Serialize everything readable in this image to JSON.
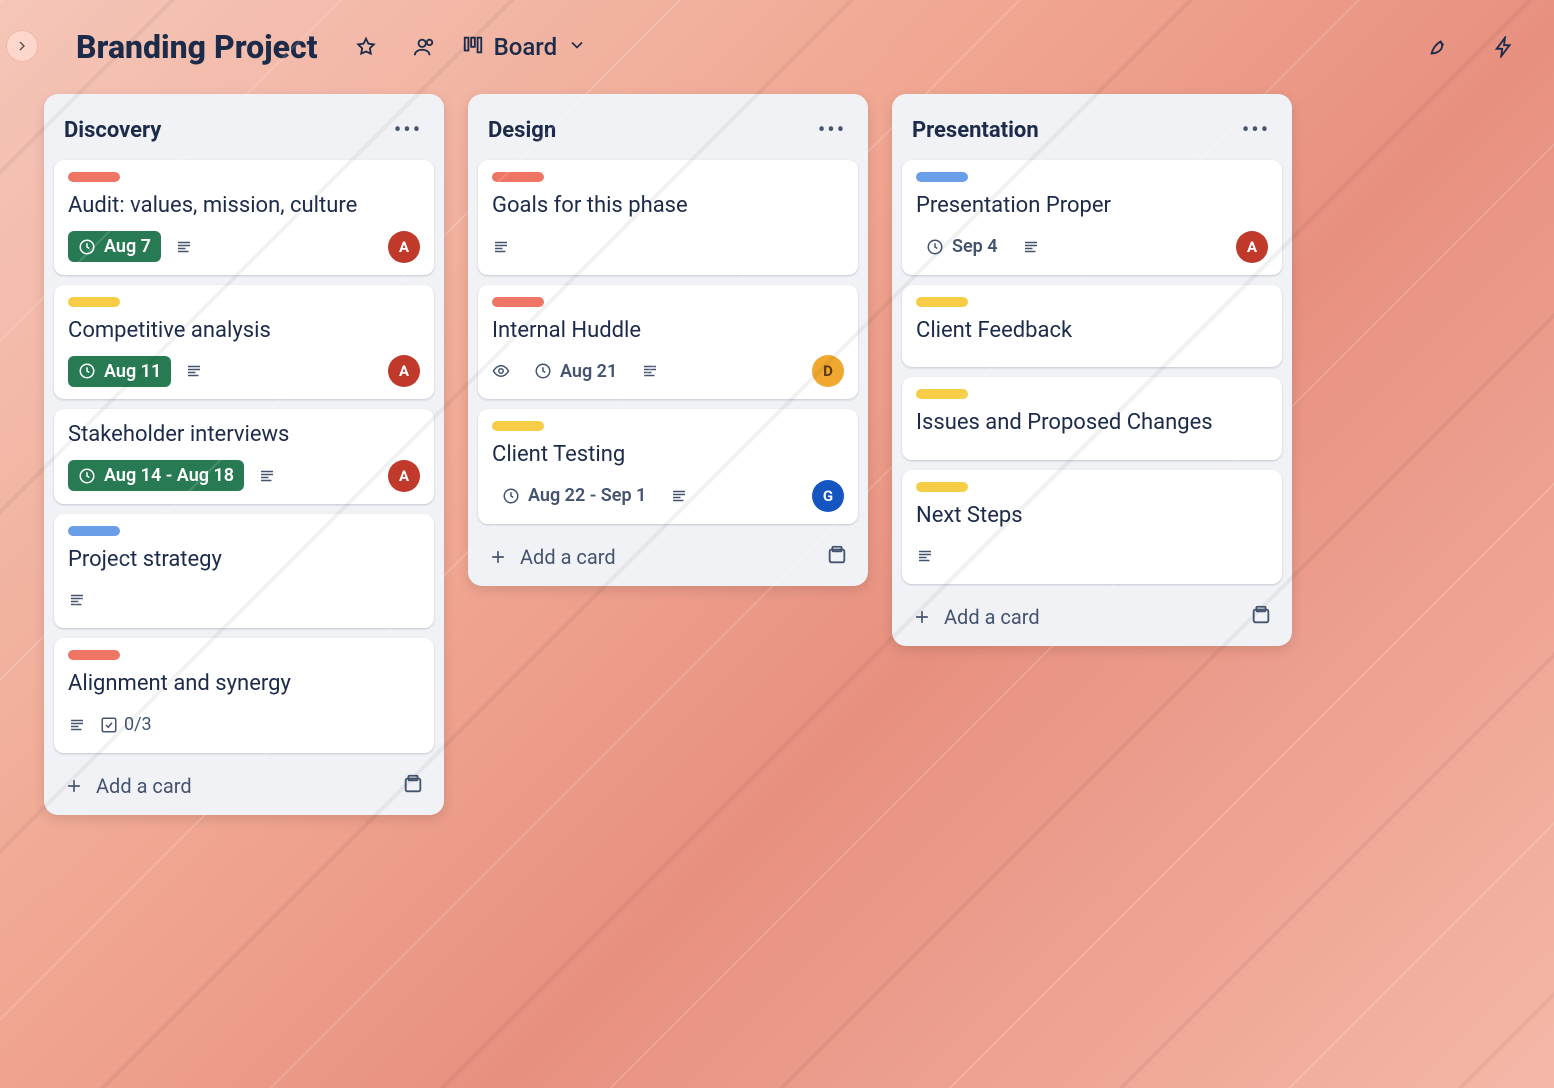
{
  "header": {
    "title": "Branding Project",
    "view_label": "Board"
  },
  "add_card_label": "Add a card",
  "lists": [
    {
      "title": "Discovery",
      "cards": [
        {
          "label": "red",
          "title": "Audit: values, mission, culture",
          "date": "Aug 7",
          "date_style": "green",
          "desc": true,
          "avatar": "A"
        },
        {
          "label": "orange",
          "title": "Competitive analysis",
          "date": "Aug 11",
          "date_style": "green",
          "desc": true,
          "avatar": "A"
        },
        {
          "label": "",
          "title": "Stakeholder interviews",
          "date": "Aug 14 - Aug 18",
          "date_style": "green",
          "desc": true,
          "avatar": "A"
        },
        {
          "label": "blue",
          "title": "Project strategy",
          "desc": true
        },
        {
          "label": "red",
          "title": "Alignment and synergy",
          "desc": true,
          "checklist": "0/3"
        }
      ]
    },
    {
      "title": "Design",
      "cards": [
        {
          "label": "red",
          "title": "Goals for this phase",
          "desc": true
        },
        {
          "label": "red",
          "title": "Internal Huddle",
          "watch": true,
          "date": "Aug 21",
          "date_style": "plain",
          "desc": true,
          "avatar": "D"
        },
        {
          "label": "orange",
          "title": "Client Testing",
          "date": "Aug 22 - Sep 1",
          "date_style": "plain",
          "desc": true,
          "avatar": "G"
        }
      ]
    },
    {
      "title": "Presentation",
      "cards": [
        {
          "label": "blue",
          "title": "Presentation Proper",
          "date": "Sep 4",
          "date_style": "plain",
          "desc": true,
          "avatar": "A"
        },
        {
          "label": "orange",
          "title": "Client Feedback"
        },
        {
          "label": "orange",
          "title": "Issues and Proposed Changes"
        },
        {
          "label": "orange",
          "title": "Next Steps",
          "desc": true
        }
      ]
    }
  ]
}
